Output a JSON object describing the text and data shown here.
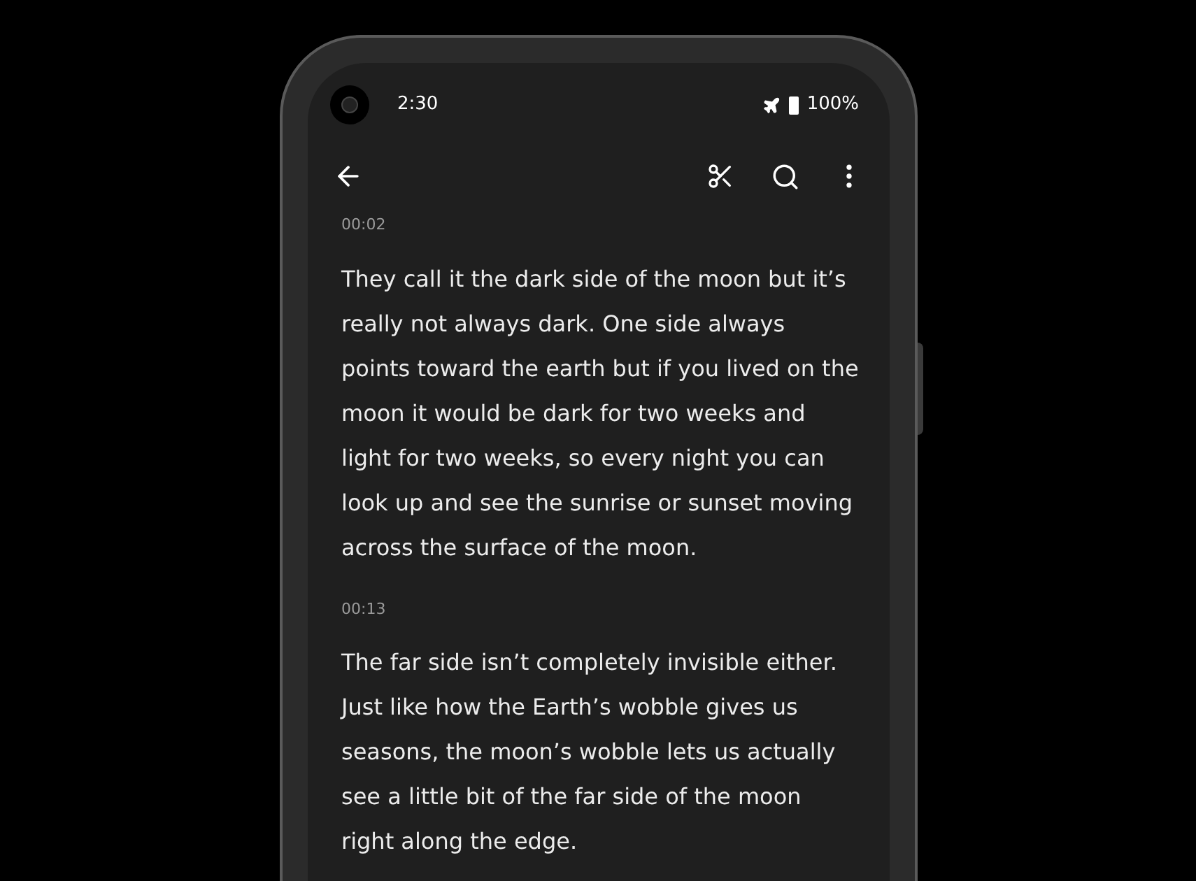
{
  "status_bar": {
    "time": "2:30",
    "battery": "100%"
  },
  "transcript": [
    {
      "time": "00:02",
      "text": "They call it the dark side of the moon but it’s really not always dark. One side always points toward the earth but if you lived on the moon it would be dark for two weeks and light for two weeks, so every night you can look up and see the sunrise or sunset moving across the surface of the moon."
    },
    {
      "time": "00:13",
      "text": "The far side isn’t completely invisible either. Just like how the Earth’s wobble gives us seasons, the moon’s wobble lets us actually see a little bit of the far side of the moon right along the edge."
    }
  ]
}
